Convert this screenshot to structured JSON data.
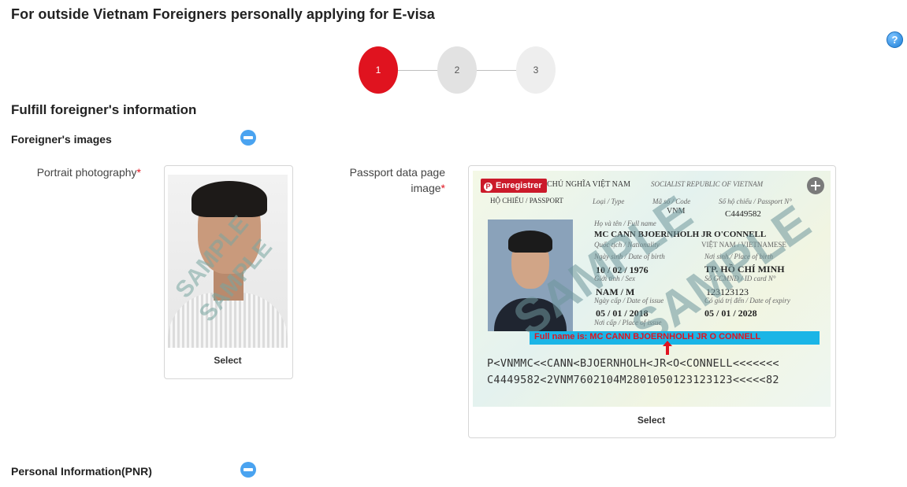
{
  "page": {
    "title": "For outside Vietnam Foreigners personally applying for E-visa",
    "help_icon": "?"
  },
  "steps": [
    {
      "label": "1",
      "active": true
    },
    {
      "label": "2",
      "active": false
    },
    {
      "label": "3",
      "active": false
    }
  ],
  "section": {
    "title": "Fulfill foreigner's information"
  },
  "images_group": {
    "title": "Foreigner's images",
    "toggle_icon": "minus-circle-icon"
  },
  "portrait": {
    "label": "Portrait photography",
    "required_mark": "*",
    "select_label": "Select",
    "watermark_1": "SAMPLE",
    "watermark_2": "SAMPLE"
  },
  "passport": {
    "label_line1": "Passport data page",
    "label_line2": "image",
    "required_mark": "*",
    "select_label": "Select",
    "save_badge": "Enregistrer",
    "save_badge_icon": "pinterest-icon",
    "header_text": "Ã HỘI CHỦ NGHĨA VIỆT NAM",
    "header_text_en": "SOCIALIST REPUBLIC OF VIETNAM",
    "doc_type": "HỘ CHIẾU / PASSPORT",
    "type_label": "Loại / Type",
    "code_label": "Mã số / Code",
    "code_value": "VNM",
    "passport_no_label": "Số hộ chiếu / Passport N°",
    "passport_no": "C4449582",
    "fullname_label": "Họ và tên / Full name",
    "fullname": "MC CANN BJOERNHOLH JR O'CONNELL",
    "nationality_label": "Quốc tịch / Nationality",
    "nationality": "VIỆT NAM / VIETNAMESE",
    "dob_label": "Ngày sinh / Date of birth",
    "dob": "10 / 02 / 1976",
    "pob_label": "Nơi sinh / Place of birth",
    "pob": "TP. HỒ CHÍ MINH",
    "sex_label": "Giới tính / Sex",
    "sex": "NAM / M",
    "id_label": "Số GCMND / ID card N°",
    "id_no": "123123123",
    "doi_label": "Ngày cấp / Date of issue",
    "doi": "05 / 01 / 2018",
    "doe_label": "Có giá trị đến / Date of expiry",
    "doe": "05 / 01 / 2028",
    "poi_label": "Nơi cấp / Place of issue",
    "name_note": "Full name is: MC CANN BJOERNHOLH JR O CONNELL",
    "mrz_line1": "P<VNMMC<<CANN<BJOERNHOLH<JR<O<CONNELL<<<<<<<",
    "mrz_line2": "C4449582<2VNM7602104M2801050123123123<<<<<82",
    "watermark": "SAMPLE"
  },
  "pnr_group": {
    "title": "Personal Information(PNR)",
    "toggle_icon": "minus-circle-icon"
  },
  "colors": {
    "accent_red": "#e0131f",
    "toggle_blue": "#4aa3f0",
    "note_bar": "#1bb5e6"
  }
}
